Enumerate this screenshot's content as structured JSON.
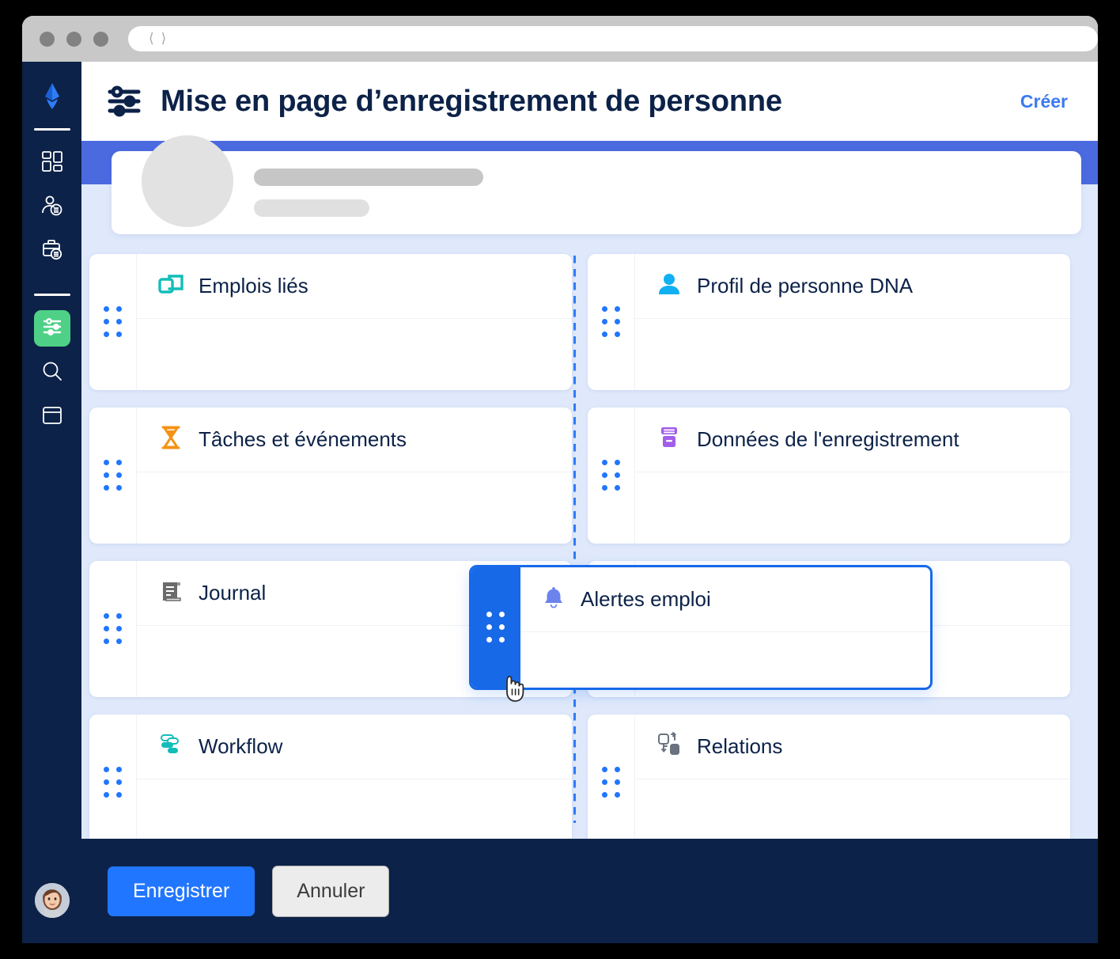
{
  "window": {
    "traffic_lights": [
      "close",
      "minimize",
      "maximize"
    ],
    "address_back_icon": "chevron-left-icon",
    "address_forward_icon": "chevron-right-icon",
    "address_value": ""
  },
  "sidebar": {
    "brand_icon": "avature-logo-icon",
    "items": [
      {
        "icon": "dashboard-grid-icon",
        "active": false
      },
      {
        "icon": "person-record-icon",
        "active": false
      },
      {
        "icon": "job-briefcase-icon",
        "active": false
      },
      {
        "icon": "settings-sliders-icon",
        "active": true
      },
      {
        "icon": "search-icon",
        "active": false
      },
      {
        "icon": "window-panel-icon",
        "active": false
      }
    ],
    "avatar": "user-avatar"
  },
  "header": {
    "icon": "settings-sliders-icon",
    "title": "Mise en page d’enregistrement de personne",
    "create_label": "Créer"
  },
  "record_header_placeholder": {
    "avatar": "placeholder-avatar",
    "line1": "",
    "line2": ""
  },
  "layout": {
    "drop_indicator": true,
    "columns": [
      {
        "name": "left-column",
        "cards": [
          {
            "title": "Emplois liés",
            "icon": "linked-jobs-icon",
            "icon_color": "#12bdb8"
          },
          {
            "title": "Tâches et événements",
            "icon": "hourglass-icon",
            "icon_color": "#f59314"
          },
          {
            "title": "Journal",
            "icon": "scroll-log-icon",
            "icon_color": "#6b6b6b"
          },
          {
            "title": "Workflow",
            "icon": "workflow-icon",
            "icon_color": "#12bdb8"
          }
        ]
      },
      {
        "name": "right-column",
        "cards": [
          {
            "title": "Profil de personne DNA",
            "icon": "person-icon",
            "icon_color": "#11b0f2"
          },
          {
            "title": "Données de l'enregistrement",
            "icon": "record-data-icon",
            "icon_color": "#a25ee8"
          },
          {
            "title": "",
            "icon": "",
            "icon_color": "#9aa6b8"
          },
          {
            "title": "Relations",
            "icon": "relations-icon",
            "icon_color": "#6b7280"
          }
        ]
      }
    ]
  },
  "dragged_card": {
    "title": "Alertes emploi",
    "icon": "bell-icon",
    "icon_color": "#6b83ec",
    "cursor": "grab-hand-cursor"
  },
  "actions": {
    "save_label": "Enregistrer",
    "cancel_label": "Annuler"
  },
  "colors": {
    "sidebar_bg": "#0c2248",
    "accent_blue": "#2176ff",
    "band_blue": "#4b6ae0",
    "canvas_bg": "#dfe9fb",
    "active_green": "#4ed186",
    "link_blue": "#3b7af0"
  }
}
